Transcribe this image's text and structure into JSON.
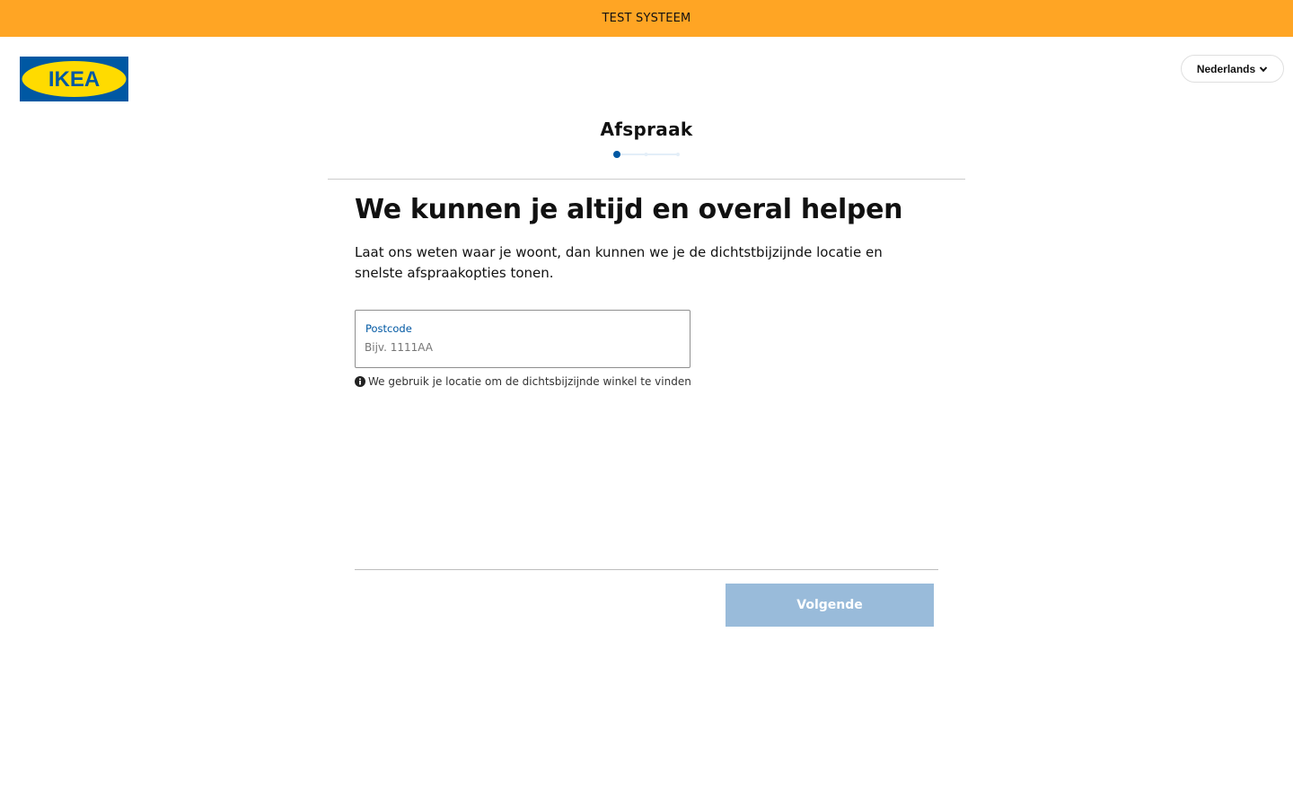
{
  "banner": {
    "text": "TEST SYSTEEM"
  },
  "header": {
    "logo_text": "IKEA",
    "language_label": "Nederlands",
    "language_icon": "chevron-down-icon"
  },
  "stepper": {
    "title": "Afspraak",
    "total_steps": 3,
    "current_step": 1
  },
  "main": {
    "headline": "We kunnen je altijd en overal helpen",
    "intro": "Laat ons weten waar je woont, dan kunnen we je de dichtstbijzijnde locatie en snelste afspraakopties tonen.",
    "postcode": {
      "label": "Postcode",
      "placeholder": "Bijv. 1111AA",
      "value": ""
    },
    "hint": {
      "icon": "info-icon",
      "text": "We gebruik je locatie om de dichtsbijzijnde winkel te vinden"
    }
  },
  "footer": {
    "next_label": "Volgende"
  },
  "colors": {
    "banner": "#ffa524",
    "ikea_blue": "#0058a3",
    "ikea_yellow": "#ffdb00",
    "button_disabled": "#99bbda"
  }
}
